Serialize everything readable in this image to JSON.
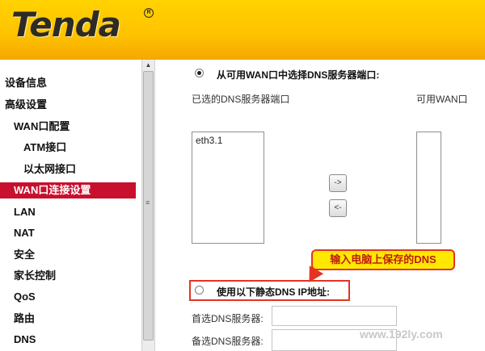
{
  "brand": {
    "logo_text": "Tenda",
    "reg_mark": "R"
  },
  "sidebar": {
    "items": [
      {
        "label": "设备信息"
      },
      {
        "label": "高级设置"
      },
      {
        "label": "WAN口配置"
      },
      {
        "label": "ATM接口"
      },
      {
        "label": "以太网接口"
      },
      {
        "label": "WAN口连接设置"
      },
      {
        "label": "LAN"
      },
      {
        "label": "NAT"
      },
      {
        "label": "安全"
      },
      {
        "label": "家长控制"
      },
      {
        "label": "QoS"
      },
      {
        "label": "路由"
      },
      {
        "label": "DNS"
      }
    ],
    "active_index": 5
  },
  "scrollbar": {
    "up_arrow": "▲",
    "grip": "≡"
  },
  "dns": {
    "option_wan": {
      "label": "从可用WAN口中选择DNS服务器端口:",
      "selected": true
    },
    "selected_ports_label": "已选的DNS服务器端口",
    "available_wan_label": "可用WAN口",
    "selected_ports": [
      "eth3.1"
    ],
    "available_ports": [],
    "move_right_label": "->",
    "move_left_label": "<-",
    "option_static": {
      "label": "使用以下静态DNS IP地址:",
      "selected": false
    },
    "primary_label": "首选DNS服务器:",
    "primary_value": "",
    "secondary_label": "备选DNS服务器:",
    "secondary_value": ""
  },
  "annotation": {
    "callout_text": "输入电脑上保存的DNS",
    "accent_color": "#e53322",
    "callout_bg": "#ffe800"
  },
  "watermark": "www.192ly.com"
}
